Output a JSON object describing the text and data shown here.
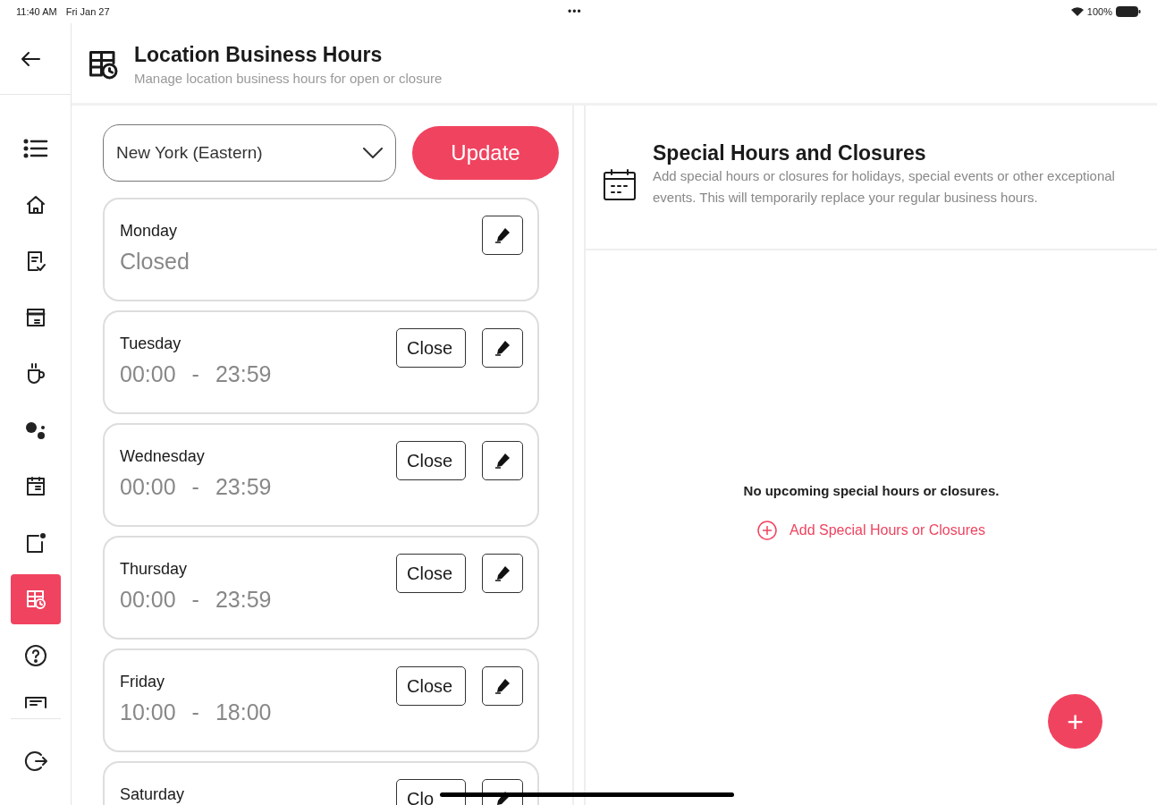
{
  "status_bar": {
    "time": "11:40 AM",
    "date": "Fri Jan 27",
    "dots": "•••",
    "battery": "100%"
  },
  "sidebar": {
    "items": [
      {
        "selected": false
      },
      {
        "selected": false
      },
      {
        "selected": false
      },
      {
        "selected": false
      },
      {
        "selected": false
      },
      {
        "selected": false
      },
      {
        "selected": false
      },
      {
        "selected": false
      },
      {
        "selected": true
      },
      {
        "selected": false
      },
      {
        "selected": false
      }
    ]
  },
  "header": {
    "title": "Location Business Hours",
    "subtitle": "Manage location business hours for open or closure"
  },
  "timezone": {
    "value": "New York (Eastern)"
  },
  "update_button": "Update",
  "days": [
    {
      "name": "Monday",
      "closed": true,
      "status": "Closed"
    },
    {
      "name": "Tuesday",
      "closed": false,
      "close_button": "Close",
      "open": "00:00",
      "separator": "-",
      "close": "23:59"
    },
    {
      "name": "Wednesday",
      "closed": false,
      "close_button": "Close",
      "open": "00:00",
      "separator": "-",
      "close": "23:59"
    },
    {
      "name": "Thursday",
      "closed": false,
      "close_button": "Close",
      "open": "00:00",
      "separator": "-",
      "close": "23:59"
    },
    {
      "name": "Friday",
      "closed": false,
      "close_button": "Close",
      "open": "10:00",
      "separator": "-",
      "close": "18:00"
    },
    {
      "name": "Saturday",
      "closed": false,
      "close_button": "Clo"
    }
  ],
  "special": {
    "title": "Special Hours and Closures",
    "description": "Add special hours or closures for holidays, special events or other exceptional events. This will temporarily replace your regular business hours.",
    "empty": "No upcoming special hours or closures.",
    "add_link": "Add Special Hours or Closures",
    "fab": "+"
  }
}
